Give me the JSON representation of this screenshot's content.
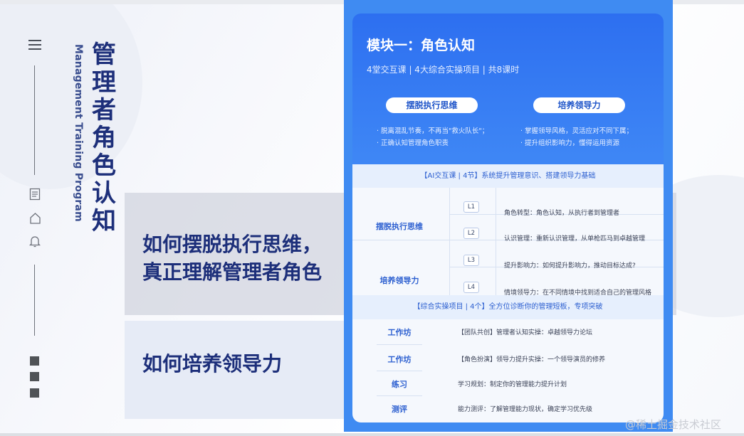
{
  "sidebar": {
    "title_zh": [
      "管",
      "理",
      "者",
      "角",
      "色",
      "认",
      "知"
    ],
    "title_en": "Management Training Program"
  },
  "bands": {
    "q1_line1": "如何摆脱执行思维，",
    "q1_line2": "真正理解管理者角色",
    "q2": "如何培养领导力"
  },
  "card": {
    "title": "模块一：角色认知",
    "subtitle": "4堂交互课 | 4大综合实操项目 | 共8课时",
    "pills": [
      "摆脱执行思维",
      "培养领导力"
    ],
    "bullets_left": [
      "· 脱离混乱节奏，不再当\"救火队长\"；",
      "· 正确认知管理角色职责"
    ],
    "bullets_right": [
      "· 掌握领导风格，灵活应对不同下属；",
      "· 提升组织影响力，懂得运用资源"
    ],
    "course_header": "【AI交互课 | 4节】系统提升管理意识、搭建领导力基础",
    "course_rows": [
      {
        "category": "摆脱执行思维",
        "level": "L1",
        "desc": "角色转型：角色认知，从执行者到管理者"
      },
      {
        "category": "",
        "level": "L2",
        "desc": "认识管理：重新认识管理，从单枪匹马到卓越管理"
      },
      {
        "category": "培养领导力",
        "level": "L3",
        "desc": "提升影响力：如何提升影响力，推动目标达成?"
      },
      {
        "category": "",
        "level": "L4",
        "desc": "情境领导力：在不同情境中找到适合自己的管理风格"
      }
    ],
    "project_header": "【综合实操项目 | 4个】全方位诊断你的管理短板，专项突破",
    "project_rows": [
      {
        "type": "工作坊",
        "desc": "【团队共创】管理者认知实操：卓越领导力论坛"
      },
      {
        "type": "工作坊",
        "desc": "【角色扮演】领导力提升实操：一个领导演员的修养"
      },
      {
        "type": "练习",
        "desc": "学习规划：制定你的管理能力提升计划"
      },
      {
        "type": "测评",
        "desc": "能力测评：了解管理能力现状，确定学习优先级"
      }
    ]
  },
  "watermark": "@稀土掘金技术社区",
  "icons": {
    "menu": "menu-icon",
    "doc": "document-icon",
    "home": "home-icon",
    "bell": "bell-icon"
  },
  "colors": {
    "title_navy": "#1d2f7a",
    "card_blue": "#3f8bf2",
    "accent_blue": "#2c5fd0"
  }
}
